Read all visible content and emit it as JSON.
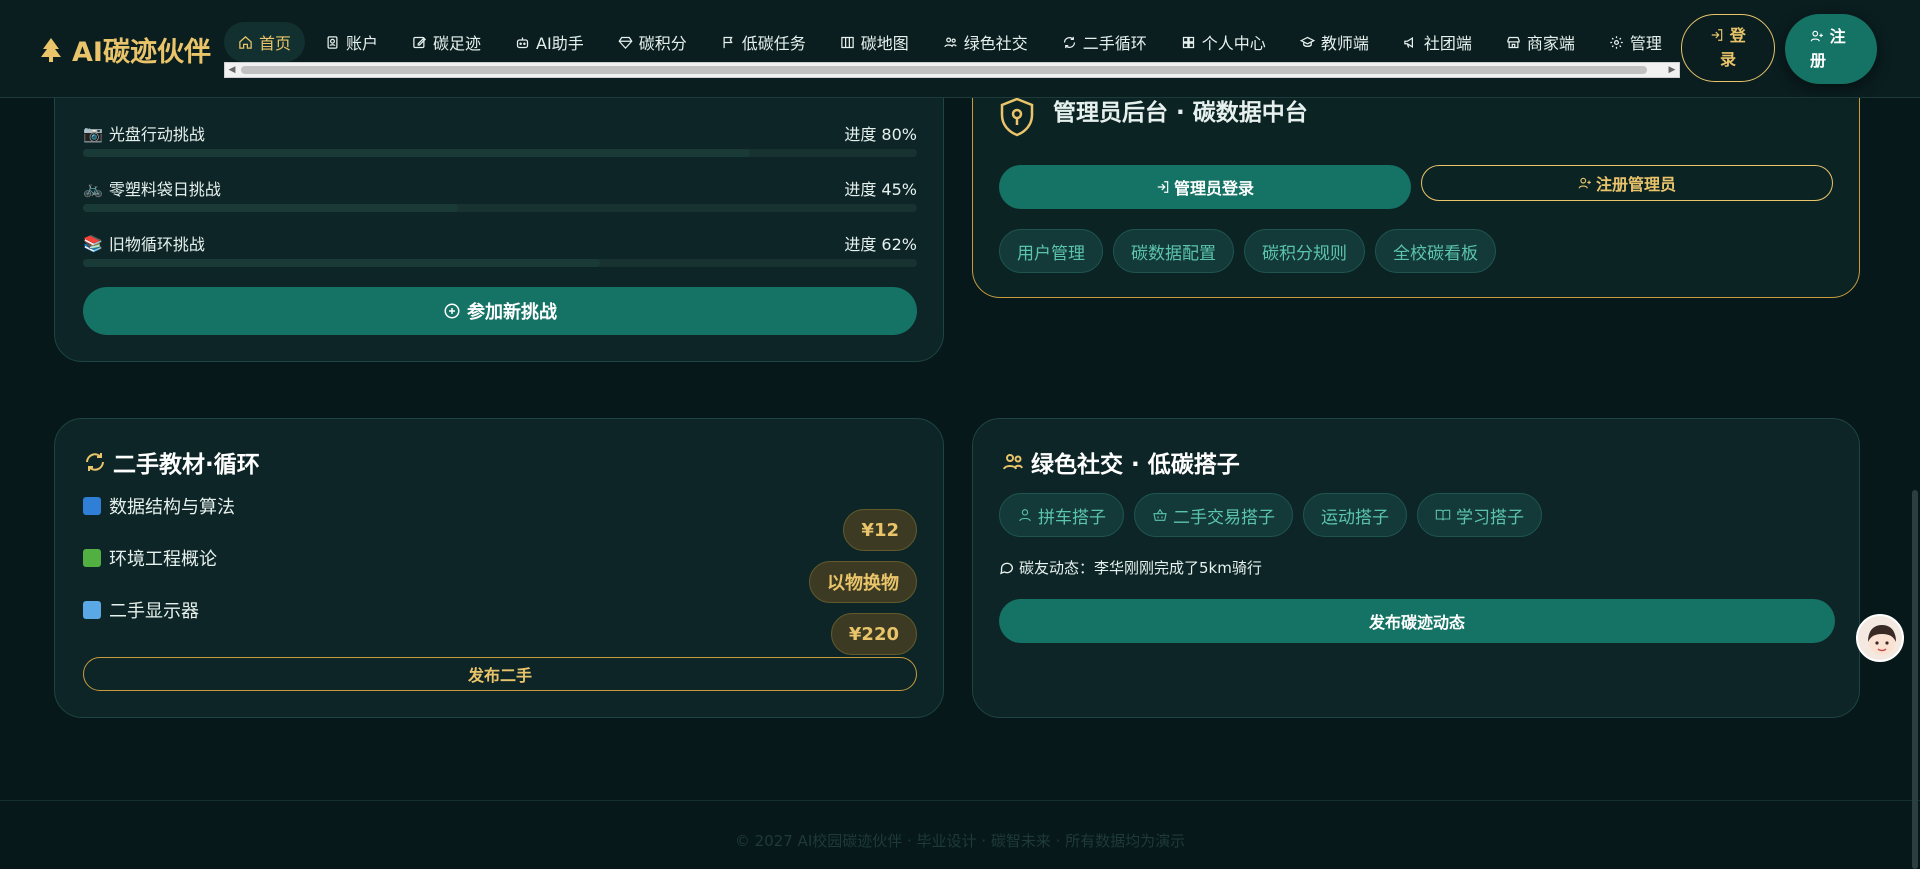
{
  "brand": {
    "name": "AI碳迹伙伴",
    "icon": "tree-icon"
  },
  "nav": {
    "items": [
      {
        "label": "首页",
        "icon": "home-icon",
        "active": true
      },
      {
        "label": "账户",
        "icon": "id-card-icon"
      },
      {
        "label": "碳足迹",
        "icon": "edit-icon"
      },
      {
        "label": "AI助手",
        "icon": "robot-icon"
      },
      {
        "label": "碳积分",
        "icon": "gem-icon"
      },
      {
        "label": "低碳任务",
        "icon": "flag-icon"
      },
      {
        "label": "碳地图",
        "icon": "map-icon"
      },
      {
        "label": "绿色社交",
        "icon": "users-icon"
      },
      {
        "label": "二手循环",
        "icon": "recycle-icon"
      },
      {
        "label": "个人中心",
        "icon": "grid-icon"
      },
      {
        "label": "教师端",
        "icon": "graduation-cap-icon"
      },
      {
        "label": "社团端",
        "icon": "megaphone-icon"
      },
      {
        "label": "商家端",
        "icon": "shop-icon"
      },
      {
        "label": "管理",
        "icon": "gear-icon"
      }
    ]
  },
  "auth": {
    "login_label": "登录",
    "register_label": "注册"
  },
  "challenges": {
    "items": [
      {
        "label": "光盘行动挑战",
        "progress_text": "进度 80%",
        "progress": 0.8,
        "icon": "camera-icon"
      },
      {
        "label": "零塑料袋日挑战",
        "progress_text": "进度 45%",
        "progress": 0.45,
        "icon": "bicycle-icon"
      },
      {
        "label": "旧物循环挑战",
        "progress_text": "进度 62%",
        "progress": 0.62,
        "icon": "books-icon"
      }
    ],
    "join_label": "参加新挑战"
  },
  "admin": {
    "title": "管理员后台 · 碳数据中台",
    "login_label": "管理员登录",
    "register_label": "注册管理员",
    "tags": [
      "用户管理",
      "碳数据配置",
      "碳积分规则",
      "全校碳看板"
    ]
  },
  "books": {
    "title": "二手教材·循环",
    "items": [
      {
        "name": "数据结构与算法",
        "price": "¥12",
        "icon": "blue-book-icon"
      },
      {
        "name": "环境工程概论",
        "price": "以物换物",
        "icon": "green-book-icon"
      },
      {
        "name": "二手显示器",
        "price": "¥220",
        "icon": "laptop-icon"
      }
    ],
    "post_label": "发布二手"
  },
  "social": {
    "title": "绿色社交 · 低碳搭子",
    "tags": [
      {
        "label": "拼车搭子",
        "icon": "user-icon"
      },
      {
        "label": "二手交易搭子",
        "icon": "basket-icon"
      },
      {
        "label": "运动搭子",
        "icon": ""
      },
      {
        "label": "学习搭子",
        "icon": "book-open-icon"
      }
    ],
    "feed": "碳友动态：李华刚刚完成了5km骑行",
    "post_label": "发布碳迹动态"
  },
  "footer": {
    "text": "© 2027 AI校园碳迹伙伴 · 毕业设计 · 碳智未来 · 所有数据均为演示"
  },
  "colors": {
    "accent": "#157365",
    "gold": "#e9c46a",
    "background": "#06181a"
  }
}
